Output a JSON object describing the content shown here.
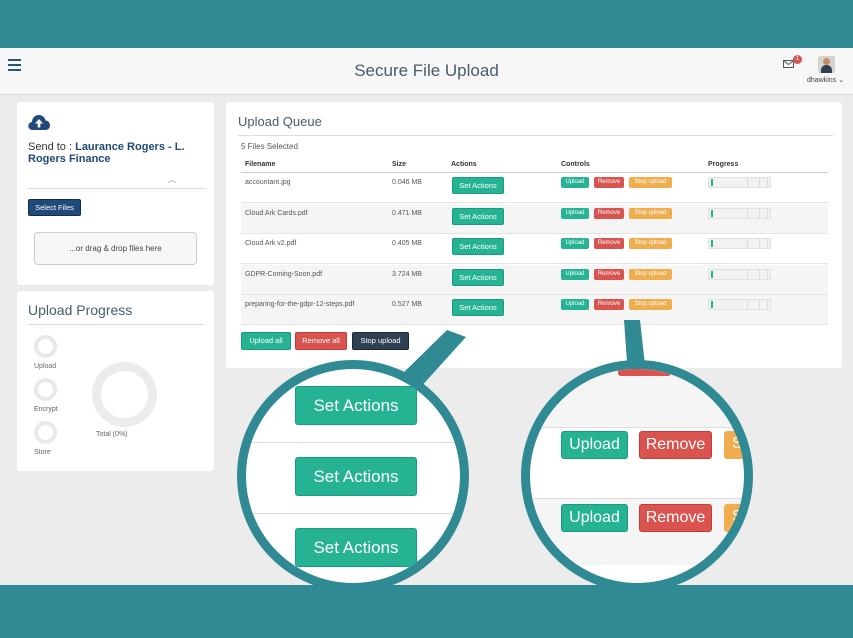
{
  "header": {
    "title": "Secure File Upload",
    "mail_badge": "1",
    "username": "dhawkins ⌄"
  },
  "send": {
    "prefix": "Send to : ",
    "recipient": "Laurance Rogers - L. Rogers Finance",
    "select_files": "Select Files",
    "dropzone": "...or drag & drop files here"
  },
  "progress": {
    "title": "Upload Progress",
    "stages": [
      "Upload",
      "Encrypt",
      "Store"
    ],
    "total_label": "Total (0%)"
  },
  "queue": {
    "title": "Upload Queue",
    "count": "5 Files Selected",
    "columns": [
      "Filename",
      "Size",
      "Actions",
      "Controls",
      "Progress"
    ],
    "files": [
      {
        "name": "accountant.jpg",
        "size": "0.046 MB",
        "progress": 0
      },
      {
        "name": "Cloud Ark Cards.pdf",
        "size": "0.471 MB",
        "progress": 0
      },
      {
        "name": "Cloud Ark v2.pdf",
        "size": "0.405 MB",
        "progress": 0
      },
      {
        "name": "GDPR-Coming-Soon.pdf",
        "size": "3.724 MB",
        "progress": 0
      },
      {
        "name": "preparing-for-the-gdpr-12-steps.pdf",
        "size": "0.527 MB",
        "progress": 0
      }
    ],
    "row_buttons": {
      "set_actions": "Set Actions",
      "upload": "Upload",
      "remove": "Remove",
      "stop": "Stop upload"
    },
    "bulk": {
      "upload_all": "Upload all",
      "remove_all": "Remove all",
      "stop_upload": "Stop upload"
    }
  },
  "zoom": {
    "left_buttons": [
      "Set Actions",
      "Set Actions",
      "Set Actions"
    ],
    "right_upload": "Upload",
    "right_remove": "Remove",
    "right_partial": "S"
  },
  "colors": {
    "teal": "#2f8a93",
    "navy": "#1f4a7a",
    "green": "#26b394",
    "red": "#d9534f",
    "orange": "#f0ad4e",
    "dark": "#2e4153"
  }
}
